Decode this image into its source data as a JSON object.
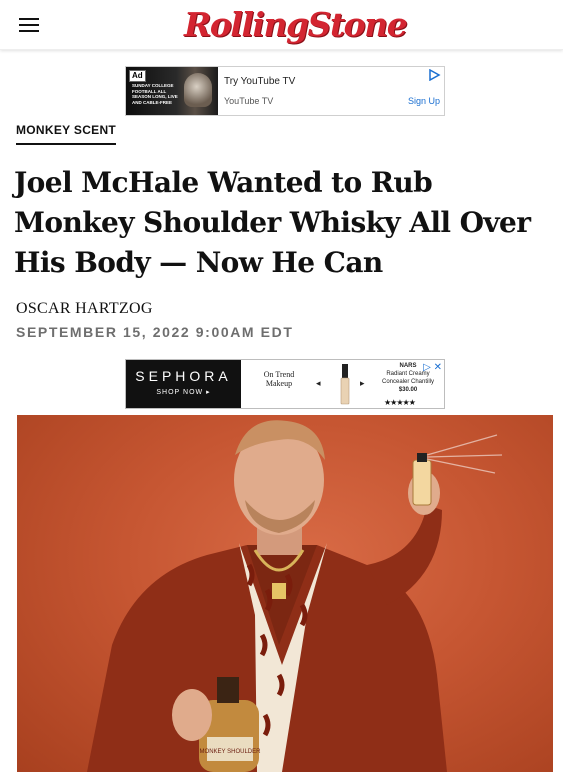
{
  "header": {
    "logo_text": "RollingStone",
    "menu_icon": "hamburger-menu-icon",
    "brand_color": "#d32531"
  },
  "ad_top": {
    "badge": "Ad",
    "image_text": "SUNDAY COLLEGE FOOTBALL ALL SEASON LONG, LIVE AND CABLE-FREE",
    "title": "Try YouTube TV",
    "sponsor": "YouTube TV",
    "cta": "Sign Up"
  },
  "article": {
    "category": "MONKEY SCENT",
    "headline": "Joel McHale Wanted to Rub Monkey Shoulder Whisky All Over His Body — Now He Can",
    "author": "OSCAR HARTZOG",
    "date": "SEPTEMBER 15, 2022 9:00AM EDT"
  },
  "ad_bottom": {
    "brand": "SEPHORA",
    "shop": "SHOP NOW ▸",
    "middle": "On Trend Makeup",
    "product_brand": "NARS",
    "product_name": "Radiant Creamy Concealer Chantilly",
    "price": "$30.00",
    "rating": "★★★★★",
    "prev": "◂",
    "next": "▸"
  },
  "hero": {
    "label": "Joel McHale holding a Monkey Shoulder bottle and spraying a fragrance",
    "bottle_label": "MONKEY SHOULDER"
  }
}
